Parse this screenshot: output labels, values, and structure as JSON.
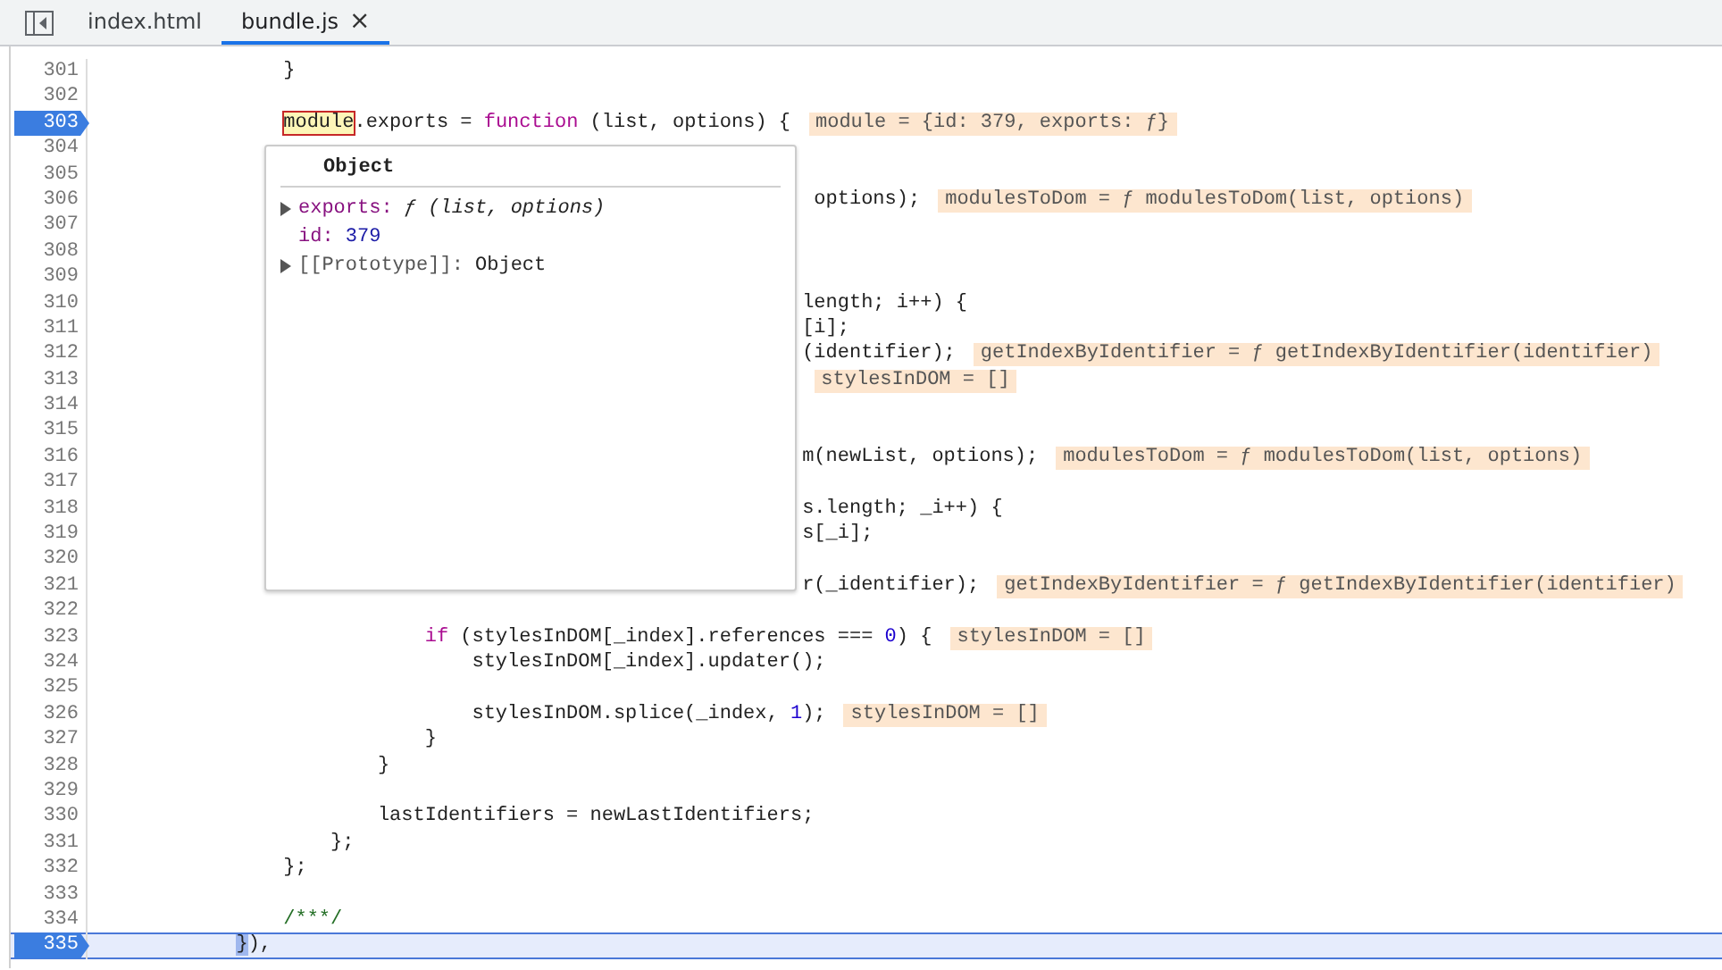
{
  "tabs": [
    {
      "label": "index.html",
      "selected": false,
      "closable": false
    },
    {
      "label": "bundle.js",
      "selected": true,
      "closable": true,
      "close": "×"
    }
  ],
  "lines": [
    {
      "number": "301",
      "breakpoint": false,
      "current": false,
      "tokens": [
        {
          "t": "                }",
          "kind": "plain"
        }
      ]
    },
    {
      "number": "302",
      "breakpoint": false,
      "current": false
    },
    {
      "number": "303",
      "breakpoint": true,
      "current": false,
      "tokens": [
        {
          "t": "                module",
          "kind": "hover"
        },
        {
          "t": ".exports = ",
          "kind": "plain"
        },
        {
          "t": "function",
          "kind": "keyword"
        },
        {
          "t": " (list, options) {",
          "kind": "plain"
        }
      ],
      "annotation": "module = {id: 379, exports: ƒ}"
    },
    {
      "number": "304",
      "breakpoint": false,
      "current": false
    },
    {
      "number": "305",
      "breakpoint": false,
      "current": false
    },
    {
      "number": "306",
      "breakpoint": false,
      "current": false,
      "tokens": [
        {
          "t": "                                                             options);",
          "kind": "plain"
        }
      ],
      "annotation": "modulesToDom = ƒ modulesToDom(list, options)"
    },
    {
      "number": "307",
      "breakpoint": false,
      "current": false
    },
    {
      "number": "308",
      "breakpoint": false,
      "current": false
    },
    {
      "number": "309",
      "breakpoint": false,
      "current": false
    },
    {
      "number": "310",
      "breakpoint": false,
      "current": false,
      "tokens": [
        {
          "t": "                                                            length; i++) {",
          "kind": "plain"
        }
      ]
    },
    {
      "number": "311",
      "breakpoint": false,
      "current": false,
      "tokens": [
        {
          "t": "                                                            [i];",
          "kind": "plain"
        }
      ]
    },
    {
      "number": "312",
      "breakpoint": false,
      "current": false,
      "tokens": [
        {
          "t": "                                                            (identifier);",
          "kind": "plain"
        }
      ],
      "annotation": "getIndexByIdentifier = ƒ getIndexByIdentifier(identifier)"
    },
    {
      "number": "313",
      "breakpoint": false,
      "current": false,
      "annotation": "                                                             stylesInDOM = []"
    },
    {
      "number": "314",
      "breakpoint": false,
      "current": false
    },
    {
      "number": "315",
      "breakpoint": false,
      "current": false
    },
    {
      "number": "316",
      "breakpoint": false,
      "current": false,
      "tokens": [
        {
          "t": "                                                            m(newList, options);",
          "kind": "plain"
        }
      ],
      "annotation": "modulesToDom = ƒ modulesToDom(list, options)"
    },
    {
      "number": "317",
      "breakpoint": false,
      "current": false
    },
    {
      "number": "318",
      "breakpoint": false,
      "current": false,
      "tokens": [
        {
          "t": "                                                            s.length; _i++) {",
          "kind": "plain"
        }
      ]
    },
    {
      "number": "319",
      "breakpoint": false,
      "current": false,
      "tokens": [
        {
          "t": "                                                            s[_i];",
          "kind": "plain"
        }
      ]
    },
    {
      "number": "320",
      "breakpoint": false,
      "current": false
    },
    {
      "number": "321",
      "breakpoint": false,
      "current": false,
      "tokens": [
        {
          "t": "                                                            r(_identifier);",
          "kind": "plain"
        }
      ],
      "annotation": "getIndexByIdentifier = ƒ getIndexByIdentifier(identifier)"
    },
    {
      "number": "322",
      "breakpoint": false,
      "current": false
    },
    {
      "number": "323",
      "breakpoint": false,
      "current": false,
      "tokens": [
        {
          "t": "                            if",
          "kind": "keyword"
        },
        {
          "t": " (stylesInDOM[_index].references === ",
          "kind": "plain"
        },
        {
          "t": "0",
          "kind": "number"
        },
        {
          "t": ") {",
          "kind": "plain"
        }
      ],
      "annotation": "stylesInDOM = []"
    },
    {
      "number": "324",
      "breakpoint": false,
      "current": false,
      "tokens": [
        {
          "t": "                                stylesInDOM[_index].updater();",
          "kind": "plain"
        }
      ]
    },
    {
      "number": "325",
      "breakpoint": false,
      "current": false
    },
    {
      "number": "326",
      "breakpoint": false,
      "current": false,
      "tokens": [
        {
          "t": "                                stylesInDOM.splice(_index, ",
          "kind": "plain"
        },
        {
          "t": "1",
          "kind": "number"
        },
        {
          "t": ");",
          "kind": "plain"
        }
      ],
      "annotation": "stylesInDOM = []"
    },
    {
      "number": "327",
      "breakpoint": false,
      "current": false,
      "tokens": [
        {
          "t": "                            }",
          "kind": "plain"
        }
      ]
    },
    {
      "number": "328",
      "breakpoint": false,
      "current": false,
      "tokens": [
        {
          "t": "                        }",
          "kind": "plain"
        }
      ]
    },
    {
      "number": "329",
      "breakpoint": false,
      "current": false
    },
    {
      "number": "330",
      "breakpoint": false,
      "current": false,
      "tokens": [
        {
          "t": "                        lastIdentifiers = newLastIdentifiers;",
          "kind": "plain"
        }
      ]
    },
    {
      "number": "331",
      "breakpoint": false,
      "current": false,
      "tokens": [
        {
          "t": "                    };",
          "kind": "plain"
        }
      ]
    },
    {
      "number": "332",
      "breakpoint": false,
      "current": false,
      "tokens": [
        {
          "t": "                };",
          "kind": "plain"
        }
      ]
    },
    {
      "number": "333",
      "breakpoint": false,
      "current": false
    },
    {
      "number": "334",
      "breakpoint": false,
      "current": false,
      "tokens": [
        {
          "t": "                /***/",
          "kind": "comment"
        }
      ]
    },
    {
      "number": "335",
      "breakpoint": true,
      "current": true,
      "tokens": [
        {
          "t": "            }",
          "kind": "caret"
        },
        {
          "t": "),",
          "kind": "plain"
        }
      ]
    }
  ],
  "popup": {
    "title": "Object",
    "rows": [
      {
        "key": "exports:",
        "kind": "property",
        "expandable": true,
        "value": {
          "text": "ƒ (list, options)",
          "kind": "function"
        }
      },
      {
        "key": "id:",
        "kind": "property",
        "expandable": false,
        "value": {
          "text": "379",
          "kind": "number"
        }
      },
      {
        "key": "[[Prototype]]:",
        "kind": "internal",
        "expandable": true,
        "value": {
          "text": "Object",
          "kind": "object"
        }
      }
    ]
  }
}
